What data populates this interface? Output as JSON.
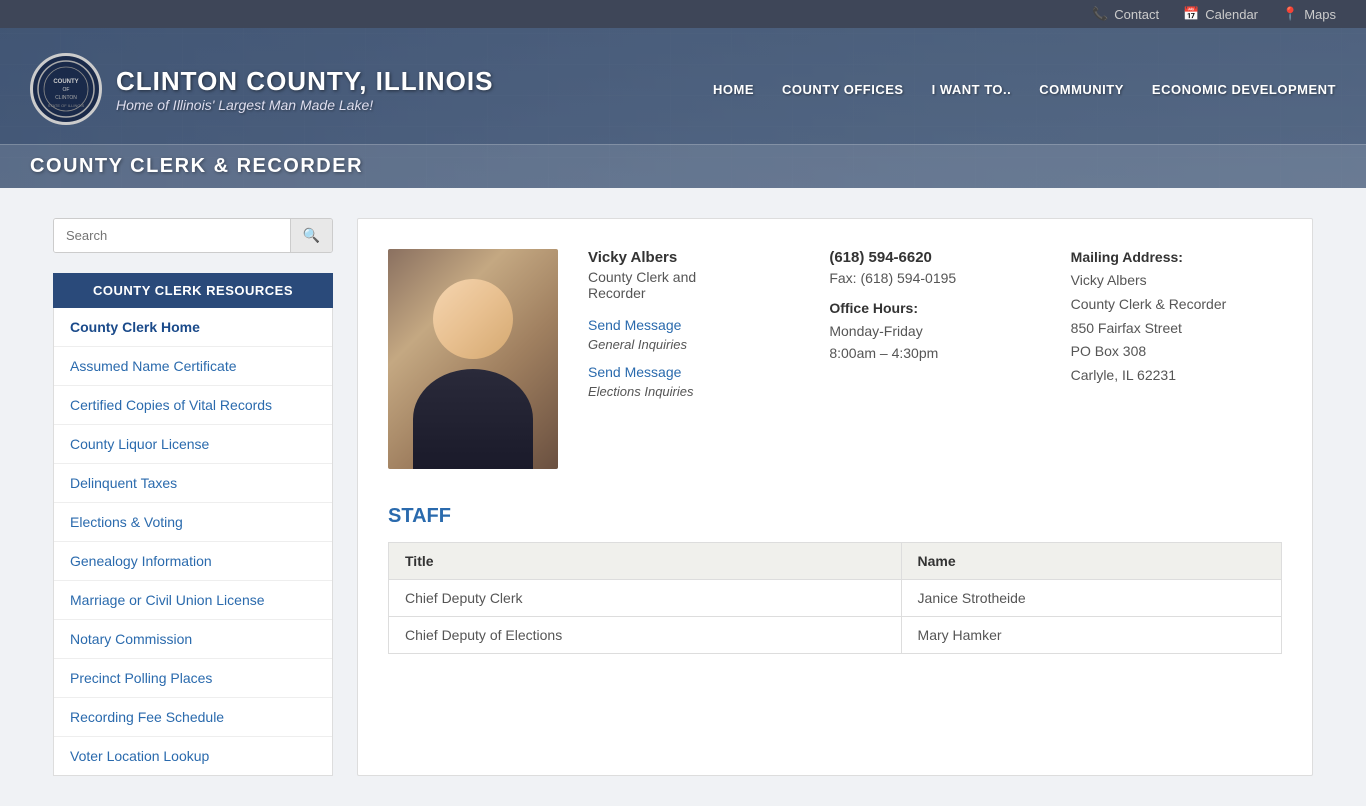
{
  "topbar": {
    "items": [
      {
        "id": "contact",
        "label": "Contact",
        "icon": "📞"
      },
      {
        "id": "calendar",
        "label": "Calendar",
        "icon": "📅"
      },
      {
        "id": "maps",
        "label": "Maps",
        "icon": "📍"
      }
    ]
  },
  "header": {
    "logo_text": "CLINTON COUNTY, ILLINOIS",
    "logo_subtitle": "Home of Illinois' Largest Man Made Lake!",
    "page_title": "COUNTY CLERK & RECORDER",
    "nav_items": [
      {
        "id": "home",
        "label": "HOME"
      },
      {
        "id": "county-offices",
        "label": "COUNTY OFFICES"
      },
      {
        "id": "i-want-to",
        "label": "I WANT TO.."
      },
      {
        "id": "community",
        "label": "COMMUNITY"
      },
      {
        "id": "economic-development",
        "label": "ECONOMIC DEVELOPMENT"
      }
    ]
  },
  "sidebar": {
    "search_placeholder": "Search",
    "resources_header": "COUNTY CLERK RESOURCES",
    "nav_items": [
      {
        "id": "home",
        "label": "County Clerk Home",
        "active": true
      },
      {
        "id": "assumed-name",
        "label": "Assumed Name Certificate"
      },
      {
        "id": "vital-records",
        "label": "Certified Copies of Vital Records"
      },
      {
        "id": "liquor-license",
        "label": "County Liquor License"
      },
      {
        "id": "delinquent-taxes",
        "label": "Delinquent Taxes"
      },
      {
        "id": "elections",
        "label": "Elections & Voting"
      },
      {
        "id": "genealogy",
        "label": "Genealogy Information"
      },
      {
        "id": "marriage-license",
        "label": "Marriage or Civil Union License"
      },
      {
        "id": "notary",
        "label": "Notary Commission"
      },
      {
        "id": "precinct",
        "label": "Precinct Polling Places"
      },
      {
        "id": "recording-fee",
        "label": "Recording Fee Schedule"
      },
      {
        "id": "voter-lookup",
        "label": "Voter Location Lookup"
      }
    ]
  },
  "profile": {
    "name": "Vicky Albers",
    "title_line1": "County Clerk and",
    "title_line2": "Recorder",
    "send_message_general_link": "Send Message",
    "send_message_general_label": "General Inquiries",
    "send_message_elections_link": "Send Message",
    "send_message_elections_label": "Elections Inquiries",
    "phone": "(618) 594-6620",
    "fax": "Fax: (618) 594-0195",
    "office_hours_label": "Office Hours:",
    "office_hours_days": "Monday-Friday",
    "office_hours_time": "8:00am – 4:30pm",
    "mailing_label": "Mailing Address:",
    "mailing_name": "Vicky Albers",
    "mailing_title": "County Clerk & Recorder",
    "mailing_address1": "850 Fairfax Street",
    "mailing_address2": "PO Box 308",
    "mailing_city": "Carlyle, IL 62231"
  },
  "staff": {
    "section_title": "STAFF",
    "col_title": "Title",
    "col_name": "Name",
    "rows": [
      {
        "title": "Chief Deputy Clerk",
        "name": "Janice Strotheide"
      },
      {
        "title": "Chief Deputy of Elections",
        "name": "Mary Hamker"
      }
    ]
  }
}
